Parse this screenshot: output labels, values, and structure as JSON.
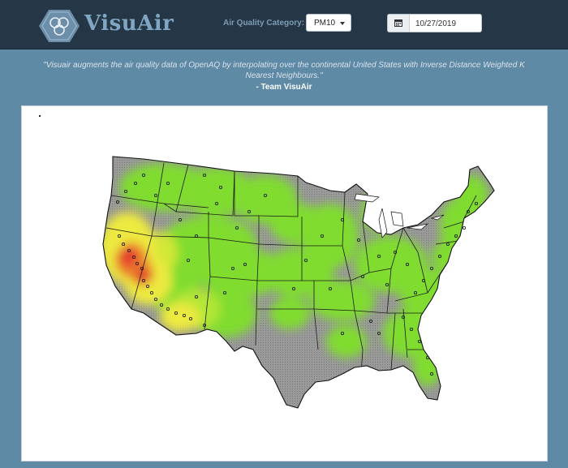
{
  "app": {
    "title": "VisuAir",
    "logo_icon": "swirl-logo-icon"
  },
  "controls": {
    "category_label": "Air Quality Category:",
    "category_value": "PM10",
    "date_value": "10/27/2019",
    "date_icon": "calendar-icon"
  },
  "banner": {
    "quote": "\"Visuair augments the air quality data of OpenAQ by interpolating over the continental United States with Inverse Distance Weighted K Nearest Neighbours.\"",
    "signature": "- Team VisuAir"
  },
  "colors": {
    "navbar": "#253746",
    "page_bg": "#5f8aa6",
    "good": "#7fe02a",
    "moderate": "#f2ef3a",
    "high": "#f07a28",
    "very_high": "#e8302a",
    "no_data": "#8e8e8e"
  }
}
